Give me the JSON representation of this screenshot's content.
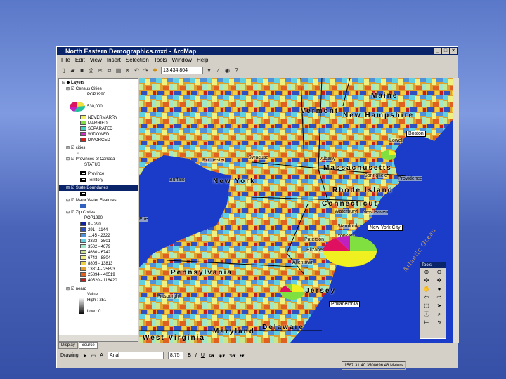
{
  "window": {
    "title": "North Eastern Demographics.mxd - ArcMap",
    "controls": [
      "_",
      "□",
      "×"
    ]
  },
  "menu": [
    "File",
    "Edit",
    "View",
    "Insert",
    "Selection",
    "Tools",
    "Window",
    "Help"
  ],
  "toolbar": {
    "scale": "13,434,804"
  },
  "toc": {
    "root": "Layers",
    "layers": [
      {
        "name": "Census Cities",
        "field": "POP1990",
        "chart_label": "530,000",
        "legend": [
          {
            "label": "NEVERMARRY",
            "color": "#f0f060"
          },
          {
            "label": "MARRIED",
            "color": "#80e040"
          },
          {
            "label": "SEPARATED",
            "color": "#40d0c0"
          },
          {
            "label": "WIDOWED",
            "color": "#d030c0"
          },
          {
            "label": "DIVORCED",
            "color": "#d02020"
          }
        ]
      },
      {
        "name": "cities"
      },
      {
        "name": "Provinces of Canada",
        "field": "STATUS",
        "legend": [
          {
            "label": "Province"
          },
          {
            "label": "Territory"
          }
        ]
      },
      {
        "name": "State Boundaries",
        "selected": true
      },
      {
        "name": "Major Water Features"
      },
      {
        "name": "Zip Codes",
        "field": "POP1990",
        "legend": [
          {
            "label": "0 - 290",
            "color": "#1020a0"
          },
          {
            "label": "291 - 1144",
            "color": "#3050c0"
          },
          {
            "label": "1145 - 2322",
            "color": "#5090d8"
          },
          {
            "label": "2323 - 3501",
            "color": "#60d0e0"
          },
          {
            "label": "3502 - 4679",
            "color": "#a0e8c8"
          },
          {
            "label": "4680 - 6742",
            "color": "#c8e890"
          },
          {
            "label": "6743 - 8804",
            "color": "#f0f080"
          },
          {
            "label": "8805 - 13813",
            "color": "#f0d040"
          },
          {
            "label": "13814 - 25893",
            "color": "#e0a030"
          },
          {
            "label": "25894 - 40519",
            "color": "#e06020"
          },
          {
            "label": "40520 - 116420",
            "color": "#c02020"
          }
        ]
      },
      {
        "name": "neard",
        "field": "Value",
        "high": "High : 251",
        "low": "Low : 0"
      }
    ]
  },
  "tabs": [
    "Display",
    "Source"
  ],
  "drawing": {
    "label": "Drawing",
    "font": "Arial",
    "size": "8.75",
    "bold": "B",
    "italic": "I",
    "underline": "U"
  },
  "status": {
    "coords": "1587.31.40  3508696.46 Meters"
  },
  "map": {
    "states": [
      "Maine",
      "Vermont",
      "New Hampshire",
      "Massachusetts",
      "Rhode Island",
      "Connecticut",
      "New York",
      "New Jersey",
      "Pennsylvania",
      "Maryland",
      "Delaware",
      "West Virginia"
    ],
    "ocean": "Atlantic Ocean",
    "cities": [
      "Rochester",
      "Syracuse",
      "Albany",
      "Buffalo",
      "Lowell",
      "Springfield",
      "Providence",
      "Waterbury",
      "New Haven",
      "Stamford",
      "Yonkers",
      "Paterson",
      "Newark",
      "Elizabeth",
      "Jersey City",
      "Allentown",
      "Erie",
      "Pittsburgh"
    ],
    "callouts": [
      "Boston",
      "New York City",
      "Philadelphia"
    ]
  },
  "tools_palette": {
    "title": "Tools"
  }
}
